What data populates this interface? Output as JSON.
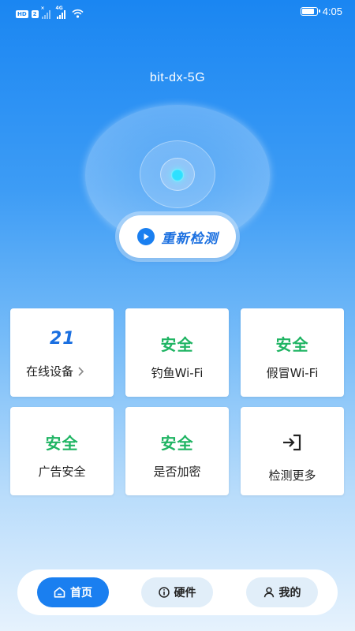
{
  "status_bar": {
    "badge_hd": "HD",
    "badge_2": "2",
    "sig1_label": "×",
    "sig2_label": "4G",
    "time": "4:05",
    "battery_fill": 0.85
  },
  "wifi": {
    "name": "bit-dx-5G"
  },
  "retest": {
    "label": "重新检测"
  },
  "cards": {
    "online_devices": {
      "value": "21",
      "label": "在线设备"
    },
    "phishing_wifi": {
      "value": "安全",
      "label": "钓鱼Wi-Fi"
    },
    "fake_wifi": {
      "value": "安全",
      "label": "假冒Wi-Fi"
    },
    "ad_security": {
      "value": "安全",
      "label": "广告安全"
    },
    "encryption": {
      "value": "安全",
      "label": "是否加密"
    },
    "more_checks": {
      "label": "检测更多"
    }
  },
  "bottom_nav": {
    "home": "首页",
    "hardware": "硬件",
    "mine": "我的"
  },
  "colors": {
    "brand_blue": "#1a7ff0",
    "safe_green": "#1fb463"
  }
}
